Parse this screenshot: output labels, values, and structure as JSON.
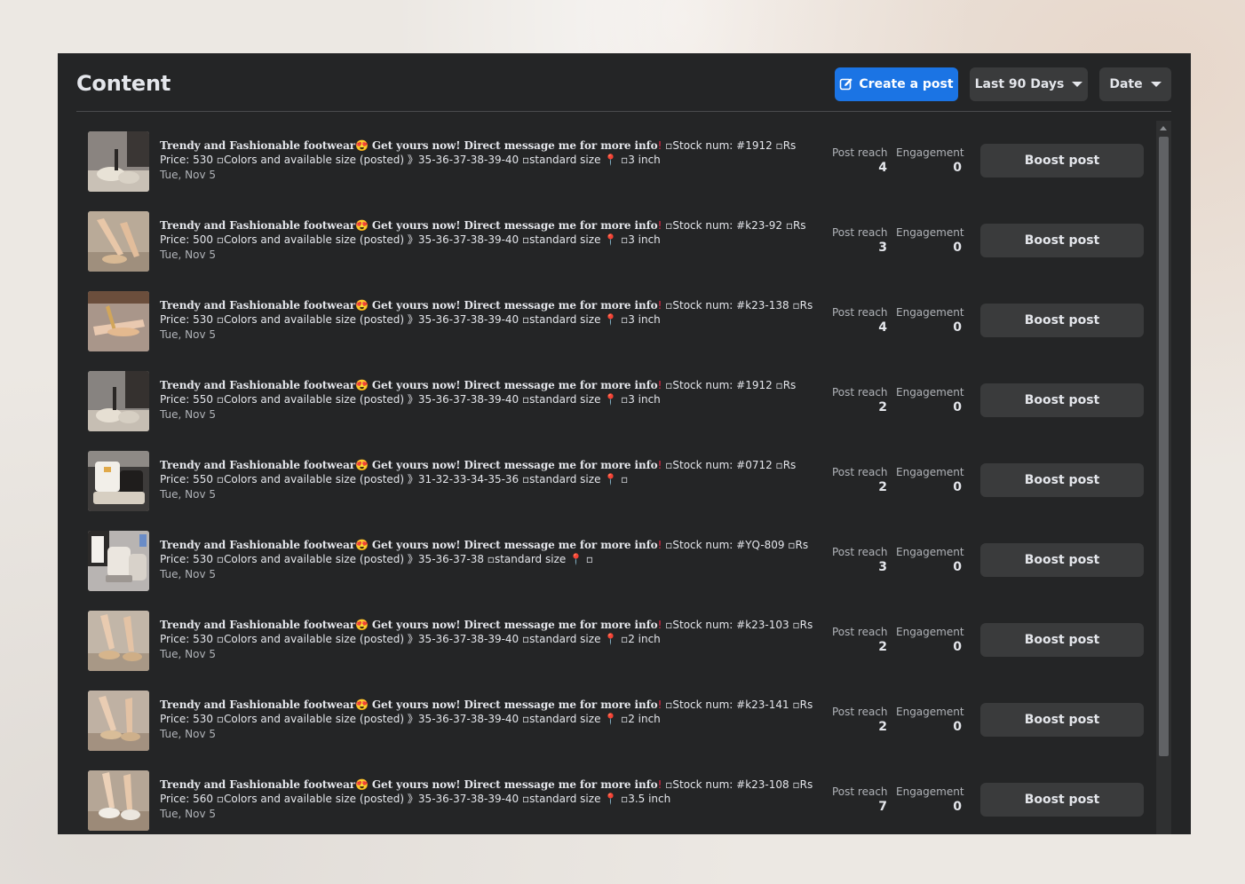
{
  "header": {
    "title": "Content",
    "create_label": "Create a post",
    "range_label": "Last 90 Days",
    "sort_label": "Date"
  },
  "icons": {
    "create": "edit-pencil-icon",
    "dropdown": "caret-down-icon"
  },
  "colors": {
    "panel_bg": "#242526",
    "primary_button": "#1b74e4",
    "secondary_button": "#3a3b3c",
    "text_primary": "#e4e6eb",
    "text_secondary": "#b0b3b8"
  },
  "metric_labels": {
    "reach": "Post reach",
    "engagement": "Engagement"
  },
  "boost_label": "Boost post",
  "posts": [
    {
      "headline": "Trendy and Fashionable footwear😍 Get yours now! Direct message me for more info",
      "details": "▫Stock num: #1912 ▫Rs Price: 530 ▫Colors and available size (posted) 》35-36-37-38-39-40 ▫standard size",
      "heel": "▫3 inch",
      "date": "Tue, Nov 5",
      "reach": "4",
      "engagement": "0"
    },
    {
      "headline": "Trendy and Fashionable footwear😍 Get yours now! Direct message me for more info",
      "details": "▫Stock num: #k23-92 ▫Rs Price: 500 ▫Colors and available size (posted) 》35-36-37-38-39-40 ▫standard size",
      "heel": "▫3 inch",
      "date": "Tue, Nov 5",
      "reach": "3",
      "engagement": "0"
    },
    {
      "headline": "Trendy and Fashionable footwear😍 Get yours now! Direct message me for more info",
      "details": "▫Stock num: #k23-138 ▫Rs Price: 530 ▫Colors and available size (posted) 》35-36-37-38-39-40 ▫standard size",
      "heel": "▫3 inch",
      "date": "Tue, Nov 5",
      "reach": "4",
      "engagement": "0"
    },
    {
      "headline": "Trendy and Fashionable footwear😍 Get yours now! Direct message me for more info",
      "details": "▫Stock num: #1912 ▫Rs Price: 550 ▫Colors and available size (posted) 》35-36-37-38-39-40 ▫standard size",
      "heel": "▫3 inch",
      "date": "Tue, Nov 5",
      "reach": "2",
      "engagement": "0"
    },
    {
      "headline": "Trendy and Fashionable footwear😍 Get yours now! Direct message me for more info",
      "details": "▫Stock num: #0712 ▫Rs Price: 550 ▫Colors and available size (posted) 》31-32-33-34-35-36 ▫standard size",
      "heel": "▫",
      "date": "Tue, Nov 5",
      "reach": "2",
      "engagement": "0"
    },
    {
      "headline": "Trendy and Fashionable footwear😍 Get yours now! Direct message me for more info",
      "details": "▫Stock num: #YQ-809 ▫Rs Price: 530 ▫Colors and available size (posted) 》35-36-37-38 ▫standard size",
      "heel": "▫",
      "date": "Tue, Nov 5",
      "reach": "3",
      "engagement": "0"
    },
    {
      "headline": "Trendy and Fashionable footwear😍 Get yours now! Direct message me for more info",
      "details": "▫Stock num: #k23-103 ▫Rs Price: 530 ▫Colors and available size (posted) 》35-36-37-38-39-40 ▫standard size",
      "heel": "▫2 inch",
      "date": "Tue, Nov 5",
      "reach": "2",
      "engagement": "0"
    },
    {
      "headline": "Trendy and Fashionable footwear😍 Get yours now! Direct message me for more info",
      "details": "▫Stock num: #k23-141 ▫Rs Price: 530 ▫Colors and available size (posted) 》35-36-37-38-39-40 ▫standard size",
      "heel": "▫2 inch",
      "date": "Tue, Nov 5",
      "reach": "2",
      "engagement": "0"
    },
    {
      "headline": "Trendy and Fashionable footwear😍 Get yours now! Direct message me for more info",
      "details": "▫Stock num: #k23-108 ▫Rs Price: 560 ▫Colors and available size (posted) 》35-36-37-38-39-40 ▫standard size",
      "heel": "▫3.5 inch",
      "date": "Tue, Nov 5",
      "reach": "7",
      "engagement": "0"
    }
  ]
}
